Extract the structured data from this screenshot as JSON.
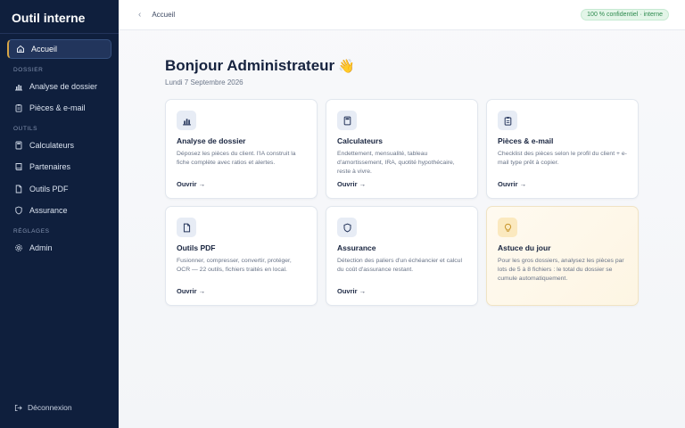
{
  "sidebar": {
    "brand": "Outil interne",
    "sections": {
      "dossier": "DOSSIER",
      "outils": "OUTILS",
      "reglages": "RÉGLAGES"
    },
    "items": {
      "accueil": "Accueil",
      "analyse": "Analyse de dossier",
      "pieces": "Pièces & e-mail",
      "calculateurs": "Calculateurs",
      "partenaires": "Partenaires",
      "outils_pdf": "Outils PDF",
      "assurance": "Assurance",
      "admin": "Admin"
    },
    "logout": "Déconnexion",
    "active_accent": "#d7a545"
  },
  "topbar": {
    "back_glyph": "‹",
    "breadcrumb": "Accueil",
    "badge": "100 % confidentiel · interne"
  },
  "main": {
    "greeting": "Bonjour Administrateur",
    "wave": "👋",
    "date": "Lundi 7 Septembre 2026"
  },
  "cards": [
    {
      "icon": "bar-chart-icon",
      "title": "Analyse de dossier",
      "desc": "Déposez les pièces du client. l'IA construit la fiche complète avec ratios et alertes.",
      "link": "Ouvrir →"
    },
    {
      "icon": "calculator-icon",
      "title": "Calculateurs",
      "desc": "Endettement, mensualité, tableau d'amortissement, IRA, quotité hypothécaire, reste à vivre.",
      "link": "Ouvrir →"
    },
    {
      "icon": "clipboard-icon",
      "title": "Pièces & e-mail",
      "desc": "Checklist des pièces selon le profil du client + e-mail type prêt à copier.",
      "link": "Ouvrir →"
    },
    {
      "icon": "file-icon",
      "title": "Outils PDF",
      "desc": "Fusionner, compresser, convertir, protéger, OCR — 22 outils, fichiers traités en local.",
      "link": "Ouvrir →"
    },
    {
      "icon": "shield-icon",
      "title": "Assurance",
      "desc": "Détection des paliers d'un échéancier et calcul du coût d'assurance restant.",
      "link": "Ouvrir →"
    }
  ],
  "tip": {
    "icon": "lightbulb-icon",
    "title": "Astuce du jour",
    "desc": "Pour les gros dossiers, analysez les pièces par lots de 5 à 8 fichiers : le total du dossier se cumule automatiquement."
  },
  "colors": {
    "sidebar_bg": "#0f1f3d",
    "badge_green": "#2d8a4e",
    "tip_bg": "#fdf5e3"
  }
}
